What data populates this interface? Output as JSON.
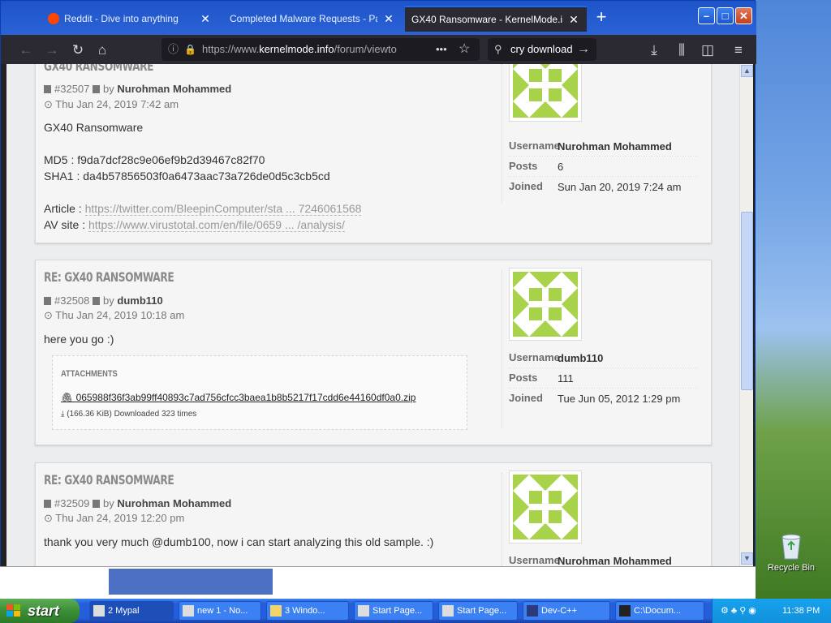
{
  "browser": {
    "tabs": [
      {
        "title": "Reddit - Dive into anything",
        "active": false
      },
      {
        "title": "Completed Malware Requests - Page S",
        "active": false
      },
      {
        "title": "GX40 Ransomware - KernelMode.info",
        "active": true
      }
    ],
    "new_tab": "+",
    "url_prefix": "https://www.",
    "url_domain": "kernelmode.info",
    "url_path": "/forum/viewto",
    "search_value": "cry download",
    "url_more": "•••"
  },
  "partial_title": "GX40 RANSOMWARE",
  "posts": [
    {
      "id": "#32507",
      "by": "by",
      "author": "Nurohman Mohammed",
      "date": "Thu Jan 24, 2019 7:42 am",
      "line1": "GX40 Ransomware",
      "md5": "MD5 : f9da7dcf28c9e06ef9b2d39467c82f70",
      "sha1": "SHA1 : da4b57856503f0a6473aac73a726de0d5c3cb5cd",
      "article_label": "Article :",
      "article_link": "https://twitter.com/BleepinComputer/sta ... 7246061568",
      "av_label": "AV site :",
      "av_link": "https://www.virustotal.com/en/file/0659 ... /analysis/",
      "profile": {
        "username_label": "Username",
        "username": "Nurohman Mohammed",
        "posts_label": "Posts",
        "posts": "6",
        "joined_label": "Joined",
        "joined": "Sun Jan 20, 2019 7:24 am"
      }
    },
    {
      "title": "RE: GX40 RANSOMWARE",
      "id": "#32508",
      "by": "by",
      "author": "dumb110",
      "date": "Thu Jan 24, 2019 10:18 am",
      "text": "here you go :)",
      "attachments_label": "ATTACHMENTS",
      "file": "065988f36f3ab99ff40893c7ad756cfcc3baea1b8b5217f17cdd6e44160df0a0.zip",
      "file_info": "(166.36 KiB) Downloaded 323 times",
      "profile": {
        "username_label": "Username",
        "username": "dumb110",
        "posts_label": "Posts",
        "posts": "111",
        "joined_label": "Joined",
        "joined": "Tue Jun 05, 2012 1:29 pm"
      }
    },
    {
      "title": "RE: GX40 RANSOMWARE",
      "id": "#32509",
      "by": "by",
      "author": "Nurohman Mohammed",
      "date": "Thu Jan 24, 2019 12:20 pm",
      "text": "thank you very much @dumb100, now i can start analyzing this old sample. :)",
      "profile": {
        "username_label": "Username",
        "username": "Nurohman Mohammed"
      }
    }
  ],
  "desktop": {
    "recycle_bin": "Recycle Bin"
  },
  "taskbar": {
    "start": "start",
    "items": [
      "2 Mypal",
      "new 1 - No...",
      "3 Windo...",
      "Start Page...",
      "Start Page...",
      "Dev-C++",
      "C:\\Docum..."
    ],
    "clock": "11:38 PM"
  },
  "colors": {
    "avatar_green": "#a8d24a",
    "tab_active": "#2b2a33",
    "xp_blue": "#245edb"
  }
}
